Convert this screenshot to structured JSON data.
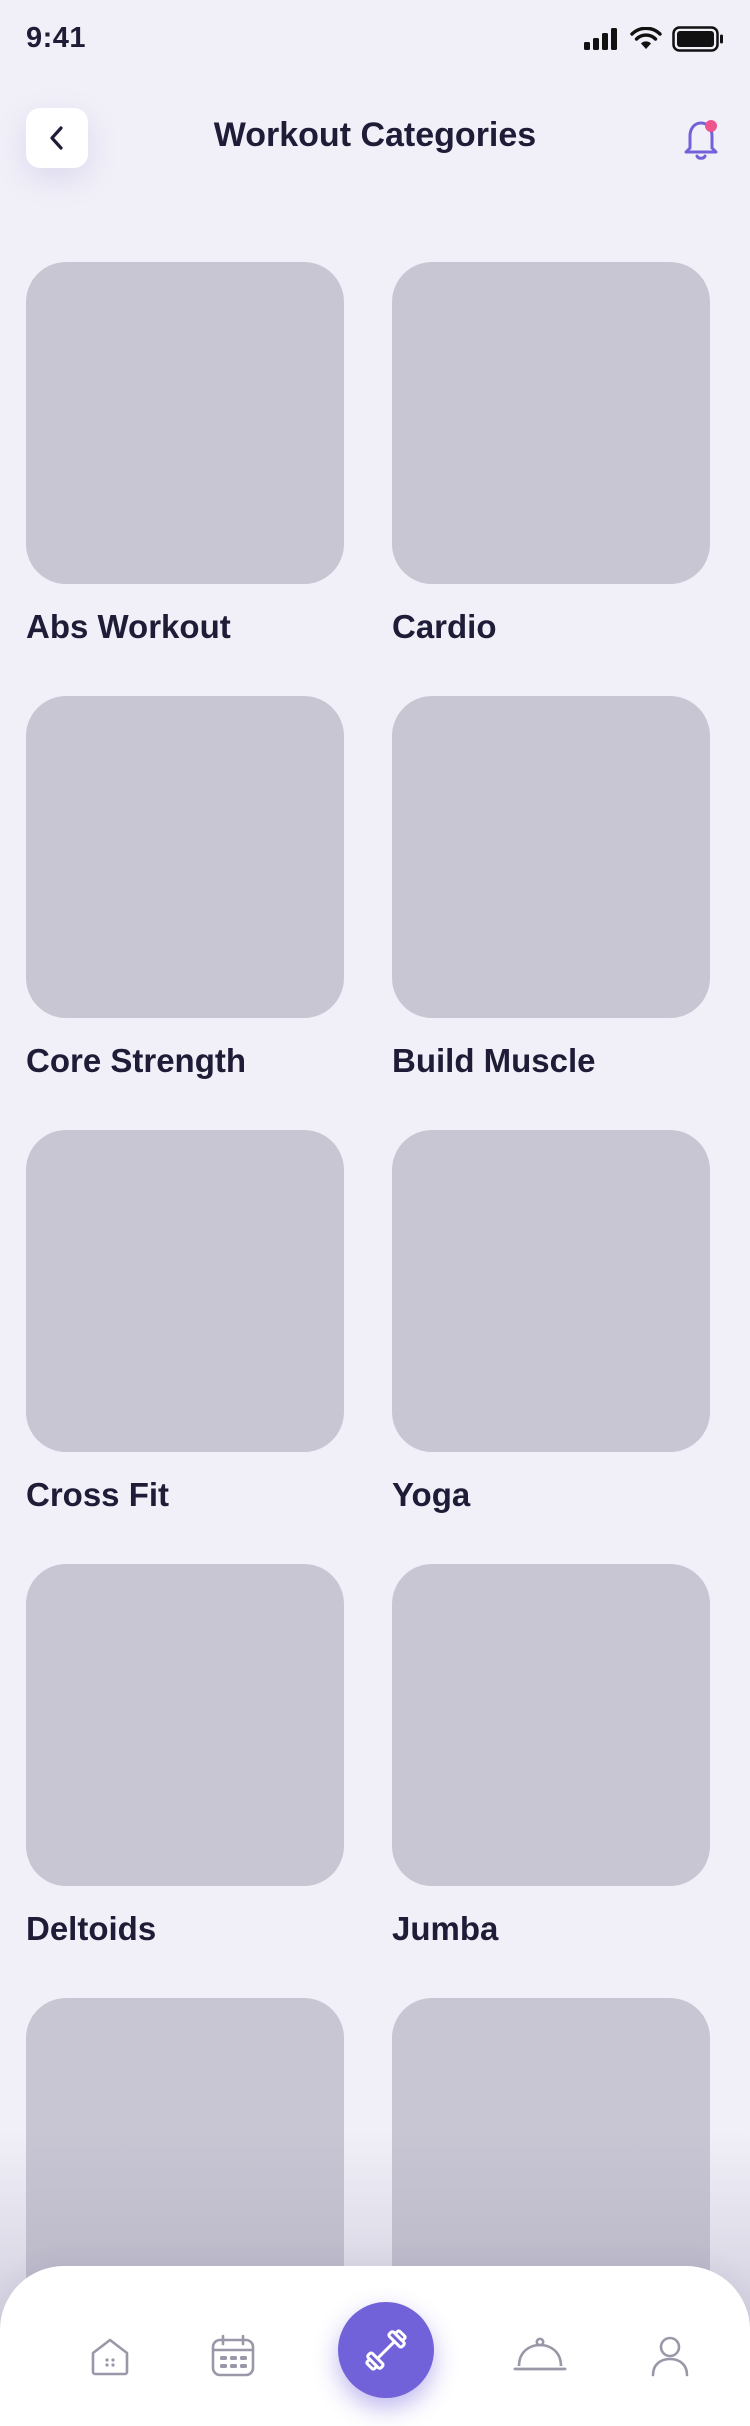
{
  "status_bar": {
    "time": "9:41"
  },
  "header": {
    "title": "Workout Categories"
  },
  "categories": [
    {
      "label": "Abs Workout"
    },
    {
      "label": "Cardio"
    },
    {
      "label": "Core Strength"
    },
    {
      "label": "Build Muscle"
    },
    {
      "label": "Cross Fit"
    },
    {
      "label": "Yoga"
    },
    {
      "label": "Deltoids"
    },
    {
      "label": "Jumba"
    },
    {
      "label": ""
    },
    {
      "label": ""
    }
  ],
  "tab_bar": {
    "items": [
      "home-icon",
      "calendar-icon",
      "dumbbell-icon",
      "food-cloche-icon",
      "profile-icon"
    ],
    "active": "dumbbell-icon"
  },
  "colors": {
    "accent": "#7162DA",
    "notification_dot": "#F0548E",
    "placeholder": "#C8C6D3",
    "background": "#F1F0F8"
  }
}
